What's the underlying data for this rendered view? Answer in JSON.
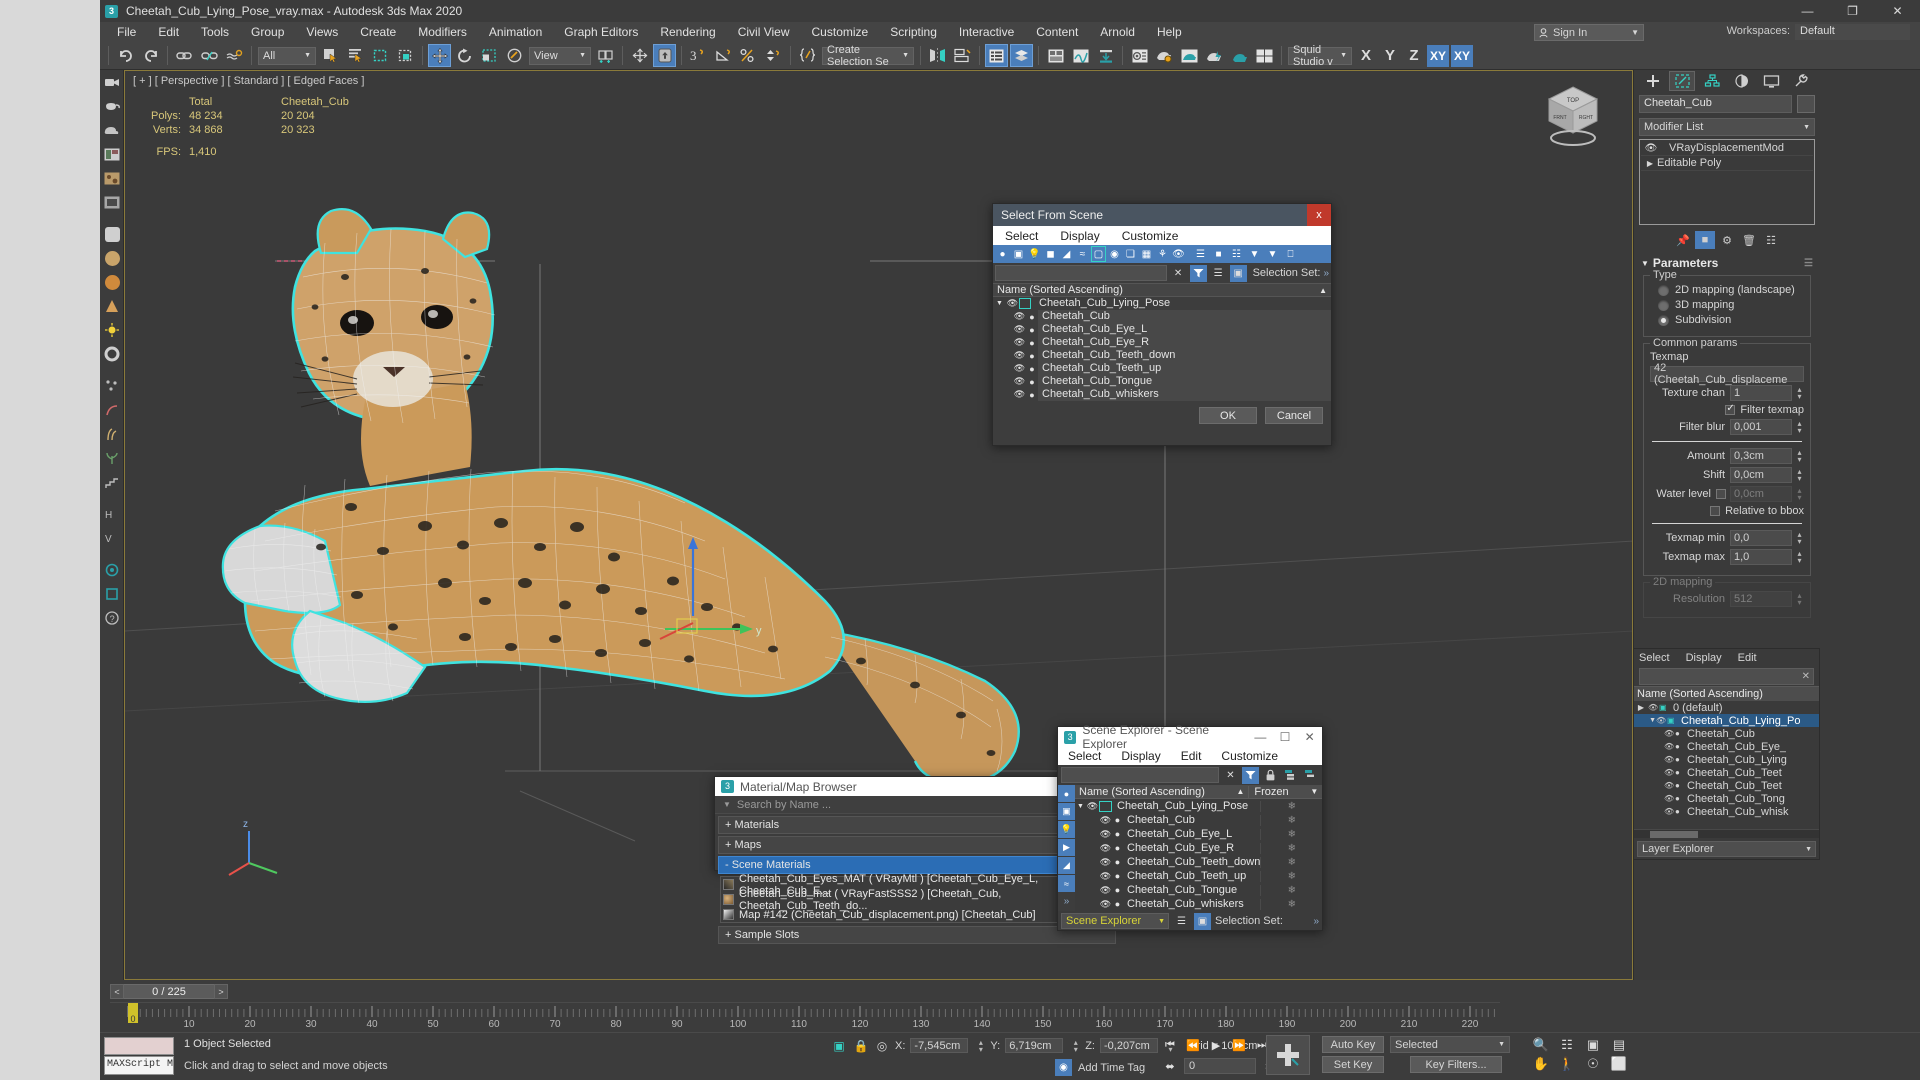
{
  "titlebar": {
    "title": "Cheetah_Cub_Lying_Pose_vray.max - Autodesk 3ds Max 2020",
    "logo": "3",
    "minimize": "—",
    "maximize": "❐",
    "close": "✕"
  },
  "menubar": {
    "items": [
      "File",
      "Edit",
      "Tools",
      "Group",
      "Views",
      "Create",
      "Modifiers",
      "Animation",
      "Graph Editors",
      "Rendering",
      "Civil View",
      "Customize",
      "Scripting",
      "Interactive",
      "Content",
      "Arnold",
      "Help"
    ],
    "sign_in": "Sign In",
    "workspaces_label": "Workspaces:",
    "workspaces_value": "Default"
  },
  "toolbar": {
    "selection_filter": "All",
    "ref_coord_system": "View",
    "named_selection_sets": "Create Selection Se",
    "render_setup_preset": "Squid Studio v",
    "axis_constraints": [
      "X",
      "Y",
      "Z",
      "XY",
      "XY"
    ]
  },
  "viewport": {
    "label": "[ + ] [ Perspective ] [ Standard ] [ Edged Faces ]",
    "stats": {
      "col_total": "Total",
      "col_object": "Cheetah_Cub",
      "polys_label": "Polys:",
      "polys_total": "48 234",
      "polys_object": "20 204",
      "verts_label": "Verts:",
      "verts_total": "34 868",
      "verts_object": "20 323",
      "fps_label": "FPS:",
      "fps_value": "1,410"
    },
    "viewcube": {
      "top": "TOP",
      "front": "FRONT",
      "right": "RIGHT"
    }
  },
  "command_panel": {
    "object_name": "Cheetah_Cub",
    "modifier_list": "Modifier List",
    "stack": [
      {
        "label": "VRayDisplacementMod",
        "icon": "eye-icon"
      },
      {
        "label": "Editable Poly",
        "icon": "expand-triangle-icon"
      }
    ],
    "parameters": {
      "rollup_title": "Parameters",
      "type_group": "Type",
      "type_options": [
        "2D mapping (landscape)",
        "3D mapping",
        "Subdivision"
      ],
      "type_selected": "Subdivision",
      "common_group": "Common params",
      "texmap_label": "Texmap",
      "texmap_value": "42 (Cheetah_Cub_displaceme",
      "texture_chan_label": "Texture chan",
      "texture_chan_value": "1",
      "filter_texmap_label": "Filter texmap",
      "filter_texmap_checked": true,
      "filter_blur_label": "Filter blur",
      "filter_blur_value": "0,001",
      "amount_label": "Amount",
      "amount_value": "0,3cm",
      "shift_label": "Shift",
      "shift_value": "0,0cm",
      "water_level_label": "Water level",
      "water_level_value": "0,0cm",
      "relative_bbox_label": "Relative to bbox",
      "texmap_min_label": "Texmap min",
      "texmap_min_value": "0,0",
      "texmap_max_label": "Texmap max",
      "texmap_max_value": "1,0",
      "mapping2d_group": "2D mapping",
      "resolution_label": "Resolution",
      "resolution_value": "512"
    }
  },
  "docked_explorer": {
    "menu": [
      "Select",
      "Display",
      "Edit"
    ],
    "header": "Name (Sorted Ascending)",
    "footer_label": "Layer Explorer",
    "rows": [
      {
        "label": "0 (default)",
        "indent": 0,
        "selected": false
      },
      {
        "label": "Cheetah_Cub_Lying_Po",
        "indent": 1,
        "selected": true
      },
      {
        "label": "Cheetah_Cub",
        "indent": 2,
        "selected": false
      },
      {
        "label": "Cheetah_Cub_Eye_",
        "indent": 2,
        "selected": false
      },
      {
        "label": "Cheetah_Cub_Lying",
        "indent": 2,
        "selected": false
      },
      {
        "label": "Cheetah_Cub_Teet",
        "indent": 2,
        "selected": false
      },
      {
        "label": "Cheetah_Cub_Teet",
        "indent": 2,
        "selected": false
      },
      {
        "label": "Cheetah_Cub_Tong",
        "indent": 2,
        "selected": false
      },
      {
        "label": "Cheetah_Cub_whisk",
        "indent": 2,
        "selected": false
      }
    ]
  },
  "select_from_scene": {
    "title": "Select From Scene",
    "close": "x",
    "menu": [
      "Select",
      "Display",
      "Customize"
    ],
    "search_placeholder": "",
    "selection_set_label": "Selection Set:",
    "column_header": "Name (Sorted Ascending)",
    "rows": [
      {
        "label": "Cheetah_Cub_Lying_Pose",
        "root": true
      },
      {
        "label": "Cheetah_Cub",
        "root": false
      },
      {
        "label": "Cheetah_Cub_Eye_L",
        "root": false
      },
      {
        "label": "Cheetah_Cub_Eye_R",
        "root": false
      },
      {
        "label": "Cheetah_Cub_Teeth_down",
        "root": false
      },
      {
        "label": "Cheetah_Cub_Teeth_up",
        "root": false
      },
      {
        "label": "Cheetah_Cub_Tongue",
        "root": false
      },
      {
        "label": "Cheetah_Cub_whiskers",
        "root": false
      }
    ],
    "ok": "OK",
    "cancel": "Cancel"
  },
  "material_browser": {
    "title": "Material/Map Browser",
    "logo": "3",
    "close": "✕",
    "search_placeholder": "Search by Name ...",
    "groups": [
      {
        "label": "+ Materials",
        "selected": false
      },
      {
        "label": "+ Maps",
        "selected": false
      },
      {
        "label": "- Scene Materials",
        "selected": true
      }
    ],
    "scene_materials": [
      {
        "label": "Cheetah_Cub_Eyes_MAT  ( VRayMtl )  [Cheetah_Cub_Eye_L, Cheetah_Cub_E...",
        "truncated": true
      },
      {
        "label": "Cheetah_Cub_mat  ( VRayFastSSS2 )  [Cheetah_Cub, Cheetah_Cub_Teeth_do...",
        "truncated": false
      },
      {
        "label": "Map #142 (Cheetah_Cub_displacement.png)  [Cheetah_Cub]",
        "truncated": false
      }
    ],
    "footer_group": "+ Sample Slots"
  },
  "scene_explorer": {
    "title": "Scene Explorer - Scene Explorer",
    "logo": "3",
    "minimize": "—",
    "maximize": "☐",
    "close": "✕",
    "menu": [
      "Select",
      "Display",
      "Edit",
      "Customize"
    ],
    "col_name": "Name (Sorted Ascending)",
    "col_frozen": "Frozen",
    "rows": [
      {
        "label": "Cheetah_Cub_Lying_Pose",
        "root": true
      },
      {
        "label": "Cheetah_Cub",
        "root": false
      },
      {
        "label": "Cheetah_Cub_Eye_L",
        "root": false
      },
      {
        "label": "Cheetah_Cub_Eye_R",
        "root": false
      },
      {
        "label": "Cheetah_Cub_Teeth_down",
        "root": false
      },
      {
        "label": "Cheetah_Cub_Teeth_up",
        "root": false
      },
      {
        "label": "Cheetah_Cub_Tongue",
        "root": false
      },
      {
        "label": "Cheetah_Cub_whiskers",
        "root": false
      }
    ],
    "footer_combo": "Scene Explorer",
    "selection_set_label": "Selection Set:"
  },
  "timeline": {
    "current_frame": "0 / 225",
    "prev": "<",
    "next": ">",
    "ticks": [
      "10",
      "20",
      "30",
      "40",
      "50",
      "60",
      "70",
      "80",
      "90",
      "100",
      "110",
      "120",
      "130",
      "140",
      "150",
      "160",
      "170",
      "180",
      "190",
      "200",
      "210",
      "220"
    ],
    "slider_label": "0"
  },
  "statusbar": {
    "maxscript_label": "MAXScript Mi",
    "selection_status": "1 Object Selected",
    "prompt": "Click and drag to select and move objects",
    "x_label": "X:",
    "x_value": "-7,545cm",
    "y_label": "Y:",
    "y_value": "6,719cm",
    "z_label": "Z:",
    "z_value": "-0,207cm",
    "grid": "Grid = 10,0cm",
    "add_time_tag": "Add Time Tag",
    "auto_key": "Auto Key",
    "set_key": "Set Key",
    "key_mode": "Selected",
    "key_filters": "Key Filters...",
    "frame_value": "0"
  },
  "colors": {
    "accent_blue": "#4a7ebb",
    "teal": "#2aa0a8",
    "highlight_yellow": "#d8c77a",
    "selection_cyan": "#3fe3e0",
    "red_close": "#c0392b"
  }
}
